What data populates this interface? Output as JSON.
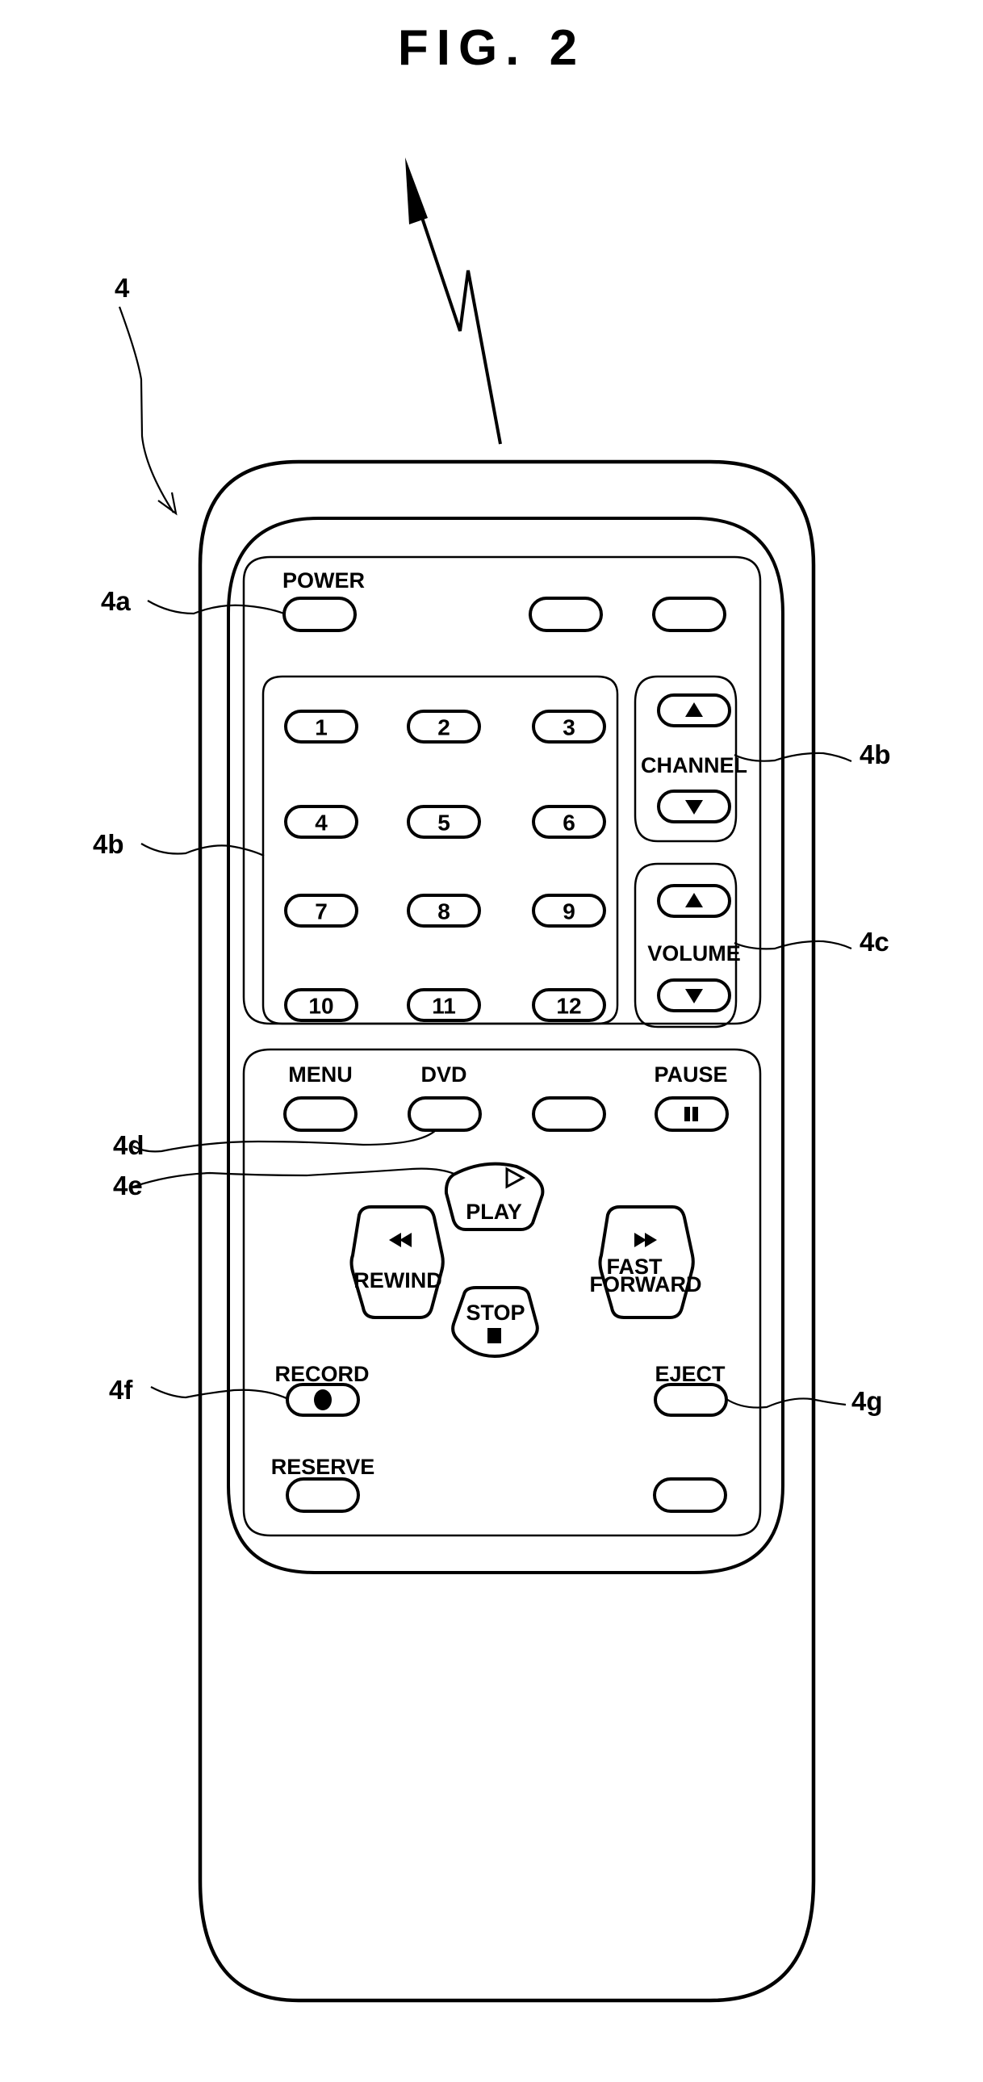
{
  "figure": {
    "title": "FIG. 2",
    "device_ref": "4"
  },
  "references": {
    "power": "4a",
    "keypad": "4b",
    "channel": "4b",
    "volume": "4c",
    "dvd": "4d",
    "play": "4e",
    "record": "4f",
    "eject": "4g"
  },
  "upper_panel": {
    "power_label": "POWER",
    "keypad": [
      "1",
      "2",
      "3",
      "4",
      "5",
      "6",
      "7",
      "8",
      "9",
      "10",
      "11",
      "12"
    ],
    "channel_label": "CHANNEL",
    "volume_label": "VOLUME"
  },
  "lower_panel": {
    "menu_label": "MENU",
    "dvd_label": "DVD",
    "pause_label": "PAUSE",
    "play_label": "PLAY",
    "rewind_label": "REWIND",
    "fast_forward_label_line1": "FAST",
    "fast_forward_label_line2": "FORWARD",
    "stop_label": "STOP",
    "record_label": "RECORD",
    "eject_label": "EJECT",
    "reserve_label": "RESERVE"
  }
}
